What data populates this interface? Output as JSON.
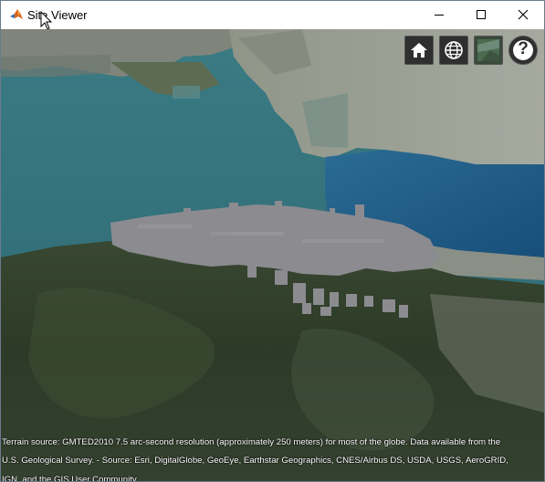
{
  "window": {
    "title": "Site Viewer",
    "icons": {
      "app": "matlab-icon",
      "minimize": "minimize-icon",
      "maximize": "maximize-icon",
      "close": "close-icon"
    }
  },
  "toolbar": {
    "home": {
      "icon": "home-icon"
    },
    "globe": {
      "icon": "globe-icon"
    },
    "basemap": {
      "icon": "basemap-picker-icon"
    },
    "help": {
      "icon": "question-mark-icon",
      "label": "?"
    }
  },
  "map": {
    "attribution_line1": "Terrain source: GMTED2010 7.5 arc-second resolution (approximately 250 meters) for most of the globe. Data available from the",
    "attribution_line2": "U.S. Geological Survey. - Source: Esri, DigitalGlobe, GeoEye, Earthstar Geographics, CNES/Airbus DS, USDA, USGS, AeroGRID,",
    "attribution_line3": "IGN, and the GIS User Community"
  },
  "colors": {
    "water": "#2f6e7a",
    "bay_water": "#1d5a86",
    "urban": "#9a9d95",
    "hills": "#2f3d2a",
    "buildings": "#8a8a8e",
    "toolbar_bg": "#2f2f2f"
  }
}
